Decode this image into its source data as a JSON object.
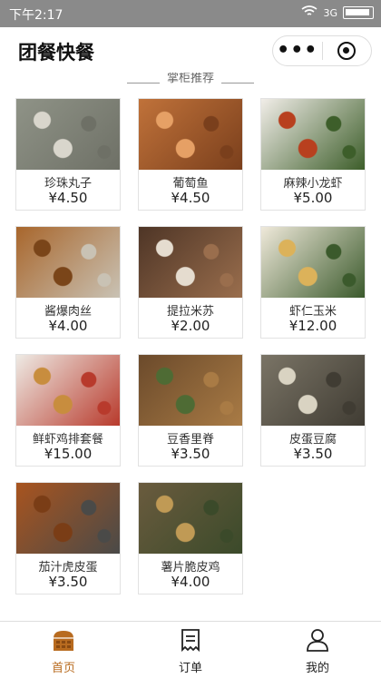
{
  "status_bar": {
    "time": "下午2:17",
    "network": "3G"
  },
  "nav": {
    "title": "团餐快餐",
    "more_glyph": "•••"
  },
  "section_title": "掌柜推荐",
  "items": [
    {
      "name": "珍珠丸子",
      "price": "¥4.50",
      "colors": [
        "#8f9387",
        "#d9d6cc",
        "#6e7066"
      ]
    },
    {
      "name": "葡萄鱼",
      "price": "¥4.50",
      "colors": [
        "#c0723a",
        "#e6a065",
        "#7a3f1c"
      ]
    },
    {
      "name": "麻辣小龙虾",
      "price": "¥5.00",
      "colors": [
        "#f1ede8",
        "#b8401f",
        "#3d5e2a"
      ]
    },
    {
      "name": "酱爆肉丝",
      "price": "¥4.00",
      "colors": [
        "#a8662c",
        "#7a4519",
        "#c9c2b4"
      ]
    },
    {
      "name": "提拉米苏",
      "price": "¥2.00",
      "colors": [
        "#4e3526",
        "#e5dccf",
        "#9a6e4d"
      ]
    },
    {
      "name": "虾仁玉米",
      "price": "¥12.00",
      "colors": [
        "#efe9da",
        "#dcb25a",
        "#3b5a2c"
      ]
    },
    {
      "name": "鲜虾鸡排套餐",
      "price": "¥15.00",
      "colors": [
        "#eeeae4",
        "#c88d3e",
        "#b83a2c"
      ]
    },
    {
      "name": "豆香里脊",
      "price": "¥3.50",
      "colors": [
        "#6b4a2b",
        "#4e6b34",
        "#a97b45"
      ]
    },
    {
      "name": "皮蛋豆腐",
      "price": "¥3.50",
      "colors": [
        "#7a7466",
        "#d9d3c2",
        "#403c33"
      ]
    },
    {
      "name": "茄汁虎皮蛋",
      "price": "¥3.50",
      "colors": [
        "#a8541f",
        "#7a3d16",
        "#4a4a48"
      ]
    },
    {
      "name": "薯片脆皮鸡",
      "price": "¥4.00",
      "colors": [
        "#6a5b3e",
        "#c09a55",
        "#3b4a2a"
      ]
    }
  ],
  "tabs": [
    {
      "label": "首页",
      "icon": "home-icon",
      "active": true
    },
    {
      "label": "订单",
      "icon": "order-icon",
      "active": false
    },
    {
      "label": "我的",
      "icon": "user-icon",
      "active": false
    }
  ],
  "colors": {
    "accent": "#b86b1f",
    "status_bar": "#8a8a8a"
  }
}
